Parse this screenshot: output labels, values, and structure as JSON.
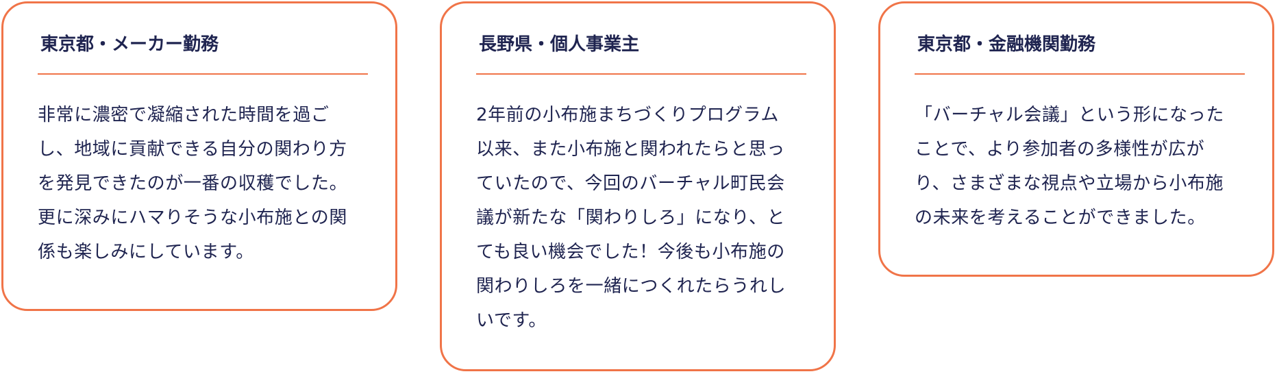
{
  "testimonials": [
    {
      "title": "東京都・メーカー勤務",
      "lines": [
        "非常に濃密で凝縮された時間を過ご",
        "し、地域に貢献できる自分の関わり方",
        "を発見できたのが一番の収穫でした。",
        "更に深みにハマりそうな小布施との関",
        "係も楽しみにしています。"
      ]
    },
    {
      "title": "長野県・個人事業主",
      "lines": [
        "2年前の小布施まちづくりプログラム",
        "以来、また小布施と関われたらと思っ",
        "ていたので、今回のバーチャル町民会",
        "議が新たな「関わりしろ」になり、と",
        "ても良い機会でした！今後も小布施の",
        "関わりしろを一緒につくれたらうれし",
        "いです。"
      ]
    },
    {
      "title": "東京都・金融機関勤務",
      "lines": [
        "「バーチャル会議」という形になった",
        "ことで、より参加者の多様性が広が",
        "り、さまざまな視点や立場から小布施",
        "の未来を考えることができました。"
      ]
    }
  ],
  "colors": {
    "accent": "#f07448",
    "text": "#1f2450"
  }
}
